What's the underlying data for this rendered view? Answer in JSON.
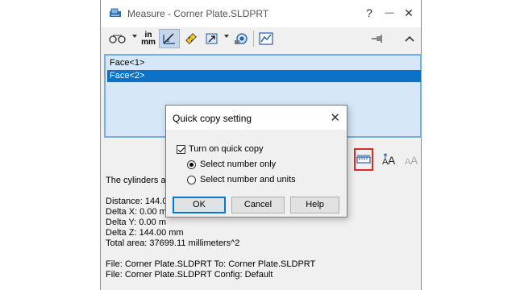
{
  "window": {
    "title": "Measure - Corner Plate.SLDPRT",
    "help_label": "?",
    "minimize_label": "—",
    "close_label": "✕"
  },
  "toolbar": {
    "units_label_top": "in",
    "units_label_bottom": "mm",
    "icons": [
      "arc-circle-measure-icon",
      "units-precision-icon",
      "show-xyz-icon",
      "point-to-point-icon",
      "projection-icon",
      "measure-history-icon",
      "create-sensor-icon",
      "pin-icon",
      "collapse-icon"
    ]
  },
  "selection_list": {
    "items": [
      {
        "label": "Face<1>",
        "selected": false
      },
      {
        "label": "Face<2>",
        "selected": true
      }
    ]
  },
  "results": {
    "line1": "The cylinders a",
    "distance": "Distance: 144.0",
    "delta_x": "Delta X: 0.00 m",
    "delta_y": "Delta Y: 0.00 m",
    "delta_z": "Delta Z: 144.00 mm",
    "total_area": "Total area: 37699.11 millimeters^2",
    "file_line": "File: Corner Plate.SLDPRT To: Corner Plate.SLDPRT",
    "config_line": "File: Corner Plate.SLDPRT Config: Default"
  },
  "dialog": {
    "title": "Quick copy setting",
    "close_label": "✕",
    "turn_on_label": "Turn on quick copy",
    "turn_on_checked": true,
    "option_number_only": "Select number only",
    "option_number_units": "Select number and units",
    "selected_option": "number_only",
    "ok_label": "OK",
    "cancel_label": "Cancel",
    "help_label": "Help"
  },
  "colors": {
    "selection": "#0a72c9",
    "list_bg": "#d6e7f7",
    "highlight_border": "#d62c2c"
  }
}
